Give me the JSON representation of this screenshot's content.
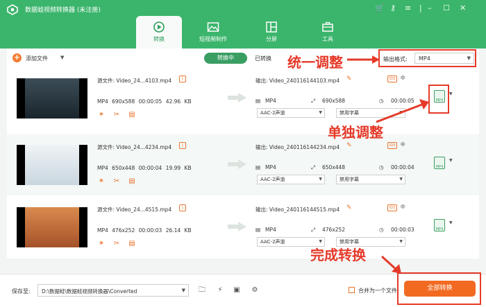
{
  "app": {
    "title": "数据蛙视频转换器 (未注册)"
  },
  "tabs": [
    {
      "label": "转换",
      "icon": "convert-icon"
    },
    {
      "label": "短视频制作",
      "icon": "image-icon"
    },
    {
      "label": "分屏",
      "icon": "split-screen-icon"
    },
    {
      "label": "工具",
      "icon": "toolbox-icon"
    }
  ],
  "toolbar": {
    "add_label": "添加文件",
    "converting_tab": "转换中",
    "converted_tab": "已转换",
    "output_format_label": "输出格式:",
    "output_format_value": "MP4"
  },
  "files": [
    {
      "source": "源文件: Video_24...4103.mp4",
      "format": "MP4",
      "resolution": "690x588",
      "duration": "00:00:05",
      "size": "42.96 KB",
      "output": "输出: Video_240116144103.mp4",
      "out_format": "MP4",
      "out_resolution": "690x588",
      "out_duration": "00:00:05",
      "audio": "AAC-2声道",
      "subtitle": "禁用字幕",
      "thumb_colors": [
        "#3c4d57",
        "#1a252c"
      ]
    },
    {
      "source": "源文件: Video_24...4234.mp4",
      "format": "MP4",
      "resolution": "650x448",
      "duration": "00:00:04",
      "size": "19.99 KB",
      "output": "输出: Video_240116144234.mp4",
      "out_format": "MP4",
      "out_resolution": "650x448",
      "out_duration": "00:00:04",
      "audio": "AAC-2声道",
      "subtitle": "禁用字幕",
      "thumb_colors": [
        "#eef3f6",
        "#c9d6de"
      ]
    },
    {
      "source": "源文件: Video_24...4515.mp4",
      "format": "MP4",
      "resolution": "476x252",
      "duration": "00:00:03",
      "size": "26.14 KB",
      "output": "输出: Video_240116144515.mp4",
      "out_format": "MP4",
      "out_resolution": "476x252",
      "out_duration": "00:00:03",
      "audio": "AAC-2声道",
      "subtitle": "禁用字幕",
      "thumb_colors": [
        "#d98a4d",
        "#a5522a"
      ]
    }
  ],
  "bottom": {
    "save_label": "保存至:",
    "save_path": "D:\\数据蛙\\数据蛙视频转换器\\Converted",
    "merge_label": "合并为一个文件",
    "convert_all": "全部转换"
  },
  "annotations": {
    "adjust_all": "统一调整",
    "adjust_single": "单独调整",
    "finish": "完成转换"
  },
  "colors": {
    "brand": "#3bb56c",
    "accent": "#f26a22",
    "highlight": "#e53a2a"
  }
}
